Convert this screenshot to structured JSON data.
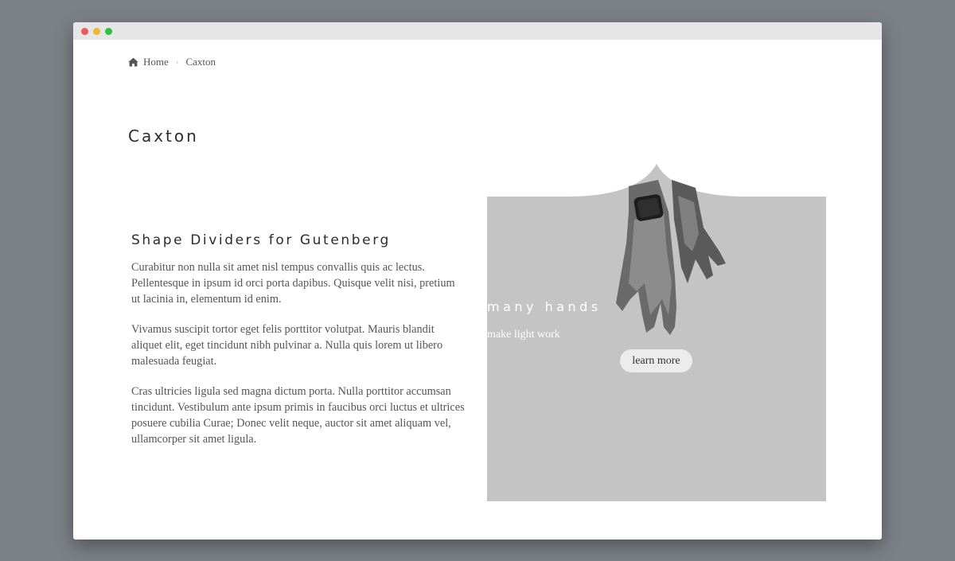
{
  "window": {
    "controls": [
      "close",
      "minimize",
      "maximize"
    ]
  },
  "breadcrumb": {
    "home_icon": "home-icon",
    "home_label": "Home",
    "separator_icon": "chevron-right-icon",
    "current_label": "Caxton"
  },
  "page": {
    "title": "Caxton"
  },
  "content": {
    "heading": "Shape Dividers for Gutenberg",
    "paragraphs": [
      "Curabitur non nulla sit amet nisl tempus convallis quis ac lectus. Pellentesque in ipsum id orci porta dapibus. Quisque velit nisi, pretium ut lacinia in, elementum id enim.",
      "Vivamus suscipit tortor eget felis porttitor volutpat. Mauris blandit aliquet elit, eget tincidunt nibh pulvinar a. Nulla quis lorem ut libero malesuada feugiat.",
      "Cras ultricies ligula sed magna dictum porta. Nulla porttitor accumsan tincidunt. Vestibulum ante ipsum primis in faucibus orci luctus et ultrices posuere cubilia Curae; Donec velit neque, auctor sit amet aliquam vel, ullamcorper sit amet ligula."
    ]
  },
  "hero": {
    "title": "many hands",
    "subtitle": "make light work",
    "button_label": "learn more",
    "background_color": "#c4c4c4",
    "image": "hands-with-smartwatch-photo"
  }
}
